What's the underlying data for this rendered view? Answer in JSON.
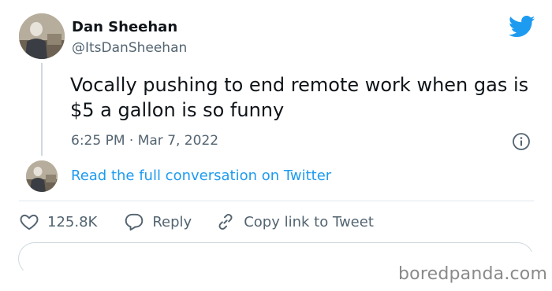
{
  "author": {
    "display_name": "Dan Sheehan",
    "handle": "@ItsDanSheehan"
  },
  "tweet": {
    "text": "Vocally pushing to end remote work when gas is $5 a gallon is so funny",
    "timestamp": "6:25 PM · Mar 7, 2022"
  },
  "conversation_link": "Read the full conversation on Twitter",
  "actions": {
    "like_count": "125.8K",
    "reply_label": "Reply",
    "copy_link_label": "Copy link to Tweet"
  },
  "watermark": "boredpanda.com",
  "icons": {
    "logo": "twitter-bird-icon",
    "info": "info-icon",
    "like": "heart-icon",
    "reply": "reply-bubble-icon",
    "copy": "link-icon"
  },
  "colors": {
    "brand": "#1d9bf0",
    "text_primary": "#0f1419",
    "text_secondary": "#536471",
    "border": "#e1e8ed"
  }
}
